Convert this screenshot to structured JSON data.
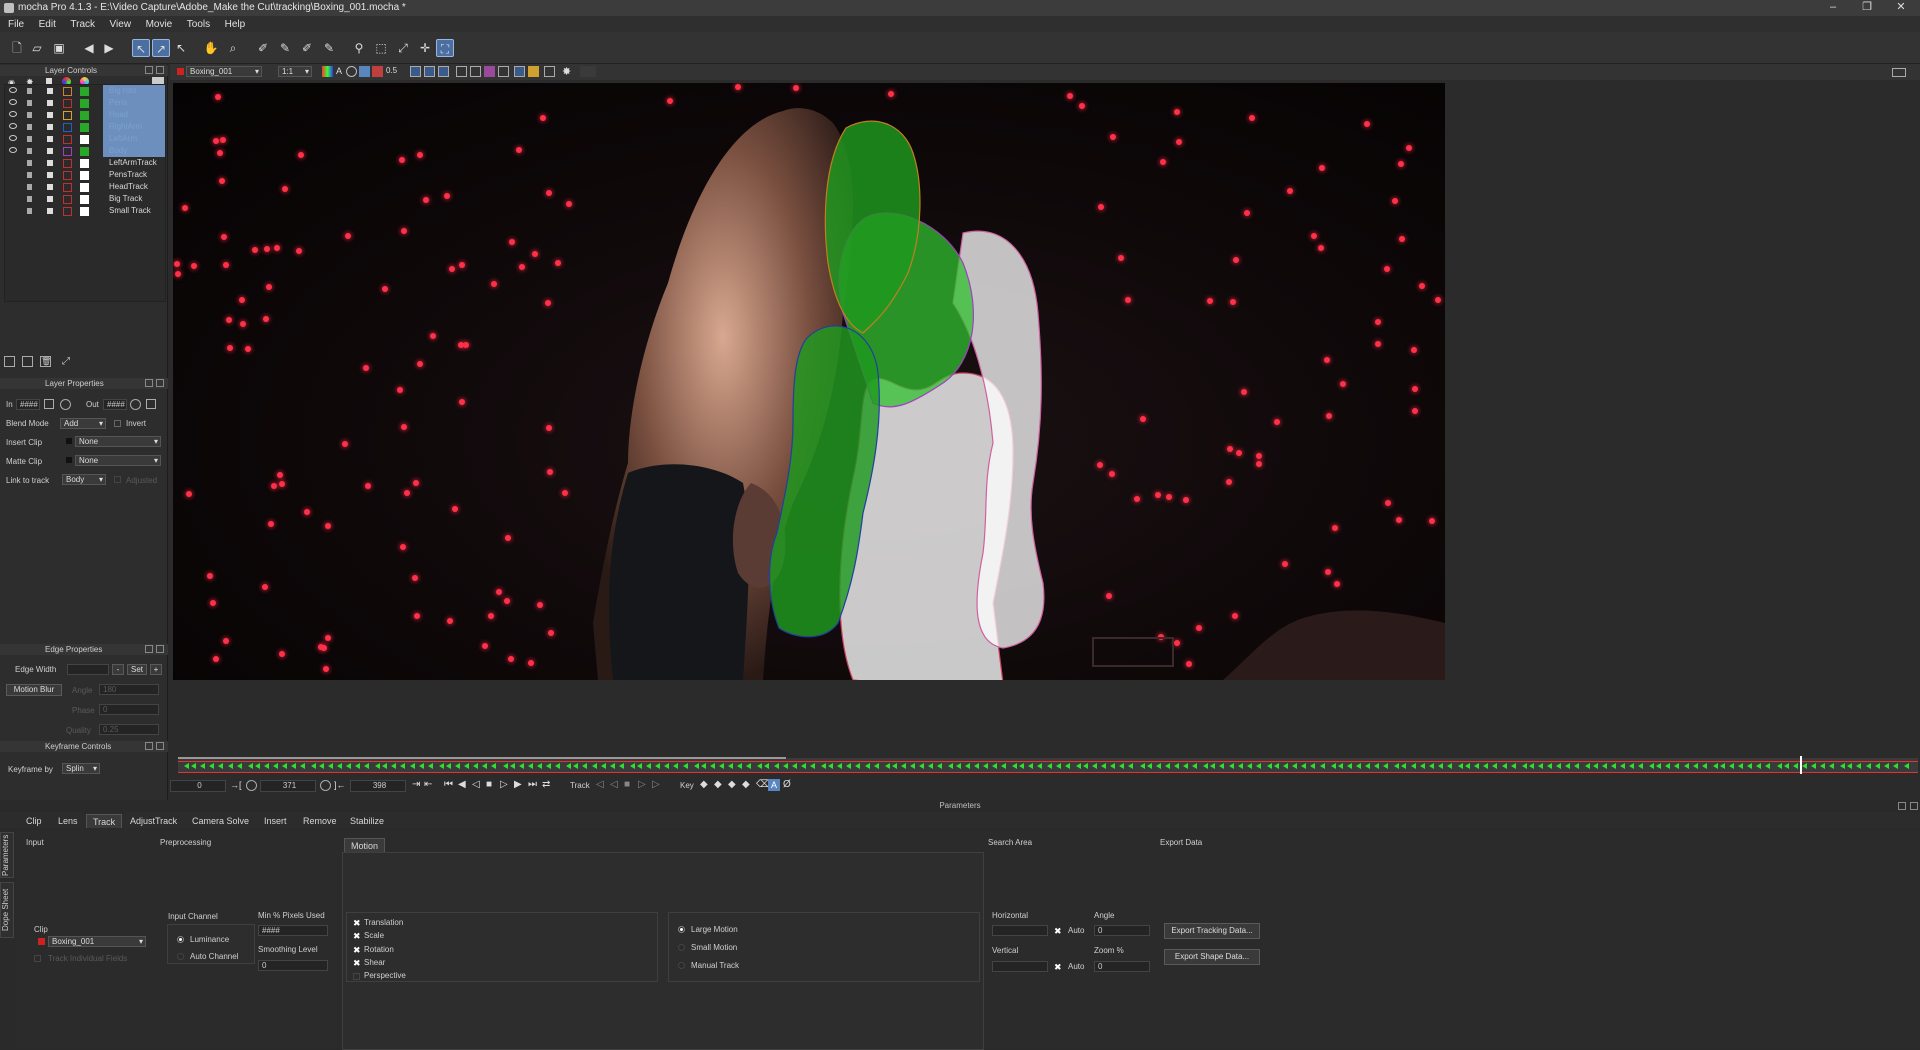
{
  "window": {
    "title": "mocha Pro 4.1.3 - E:\\Video Capture\\Adobe_Make the Cut\\tracking\\Boxing_001.mocha *"
  },
  "menu": [
    "File",
    "Edit",
    "Track",
    "View",
    "Movie",
    "Tools",
    "Help"
  ],
  "viewer_bar": {
    "clip": "Boxing_001",
    "zoom": "1:1",
    "opacity": "0.5"
  },
  "layer_controls": {
    "title": "Layer Controls",
    "layers": [
      {
        "name": "Big roto",
        "color": "#d08030",
        "matte": "#2aa82a",
        "selected": true
      },
      {
        "name": "Pens",
        "color": "#c03030",
        "matte": "#2aa82a",
        "selected": true
      },
      {
        "name": "Head",
        "color": "#e0a020",
        "matte": "#2aa82a",
        "selected": true
      },
      {
        "name": "RightArm",
        "color": "#2060c0",
        "matte": "#2aa82a",
        "selected": true
      },
      {
        "name": "LeftArm",
        "color": "#c03030",
        "matte": "#ffffff",
        "selected": true
      },
      {
        "name": "Body",
        "color": "#a040c0",
        "matte": "#2aa82a",
        "selected": true
      },
      {
        "name": "LeftArmTrack",
        "color": "#c03030",
        "matte": "#ffffff",
        "selected": false
      },
      {
        "name": "PensTrack",
        "color": "#c03030",
        "matte": "#ffffff",
        "selected": false
      },
      {
        "name": "HeadTrack",
        "color": "#c03030",
        "matte": "#ffffff",
        "selected": false
      },
      {
        "name": "Big Track",
        "color": "#c03030",
        "matte": "#ffffff",
        "selected": false
      },
      {
        "name": "Small Track",
        "color": "#c03030",
        "matte": "#ffffff",
        "selected": false
      }
    ]
  },
  "layer_properties": {
    "title": "Layer Properties",
    "in_label": "In",
    "in_value": "####",
    "out_label": "Out",
    "out_value": "####",
    "blend_mode_label": "Blend Mode",
    "blend_mode": "Add",
    "invert_label": "Invert",
    "insert_clip_label": "Insert Clip",
    "insert_clip": "None",
    "matte_clip_label": "Matte Clip",
    "matte_clip": "None",
    "link_label": "Link to track",
    "link_value": "Body",
    "adjusted_label": "Adjusted"
  },
  "edge_properties": {
    "title": "Edge Properties",
    "edge_width_label": "Edge Width",
    "set_label": "Set",
    "motion_blur_label": "Motion Blur",
    "angle_label": "Angle",
    "angle_value": "180",
    "phase_label": "Phase",
    "phase_value": "0",
    "quality_label": "Quality",
    "quality_value": "0.25"
  },
  "keyframe_controls": {
    "title": "Keyframe Controls",
    "keyframe_by_label": "Keyframe by",
    "keyframe_by": "Splin"
  },
  "timeline": {
    "start": "0",
    "current": "371",
    "end": "398",
    "track_label": "Track",
    "key_label": "Key",
    "progress": 0.35
  },
  "parameters": {
    "title": "Parameters",
    "tabs": [
      "Clip",
      "Lens",
      "Track",
      "AdjustTrack",
      "Camera Solve",
      "Insert",
      "Remove",
      "Stabilize"
    ],
    "active_tab": "Track",
    "side_tabs": [
      "Parameters",
      "Dope Sheet"
    ],
    "input": {
      "title": "Input",
      "clip_label": "Clip",
      "clip": "Boxing_001",
      "track_fields_label": "Track Individual Fields"
    },
    "preprocessing": {
      "title": "Preprocessing",
      "input_channel_label": "Input Channel",
      "luminance": "Luminance",
      "auto_channel": "Auto Channel",
      "min_pixels_label": "Min % Pixels Used",
      "min_pixels_value": "####",
      "smoothing_label": "Smoothing Level",
      "smoothing_value": "0"
    },
    "motion": {
      "title": "Motion",
      "options": [
        {
          "label": "Translation",
          "checked": true
        },
        {
          "label": "Scale",
          "checked": true
        },
        {
          "label": "Rotation",
          "checked": true
        },
        {
          "label": "Shear",
          "checked": true
        },
        {
          "label": "Perspective",
          "checked": false
        }
      ],
      "large": "Large Motion",
      "small": "Small Motion",
      "manual": "Manual Track"
    },
    "search_area": {
      "title": "Search Area",
      "horizontal_label": "Horizontal",
      "vertical_label": "Vertical",
      "auto_label": "Auto",
      "angle_label": "Angle",
      "angle_value": "0",
      "zoom_label": "Zoom %",
      "zoom_value": "0"
    },
    "export": {
      "title": "Export Data",
      "tracking_btn": "Export Tracking Data...",
      "shape_btn": "Export Shape Data..."
    }
  }
}
